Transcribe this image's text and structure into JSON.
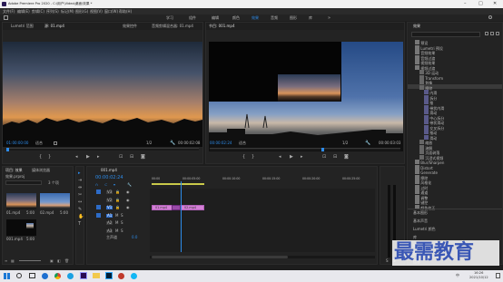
{
  "titlebar": {
    "title": "Adobe Premiere Pro 2020 - C:\\用户\\Video\\桌面\\效果 *",
    "min": "–",
    "max": "□",
    "close": "✕"
  },
  "menubar": [
    "文件(F)",
    "编辑(E)",
    "剪辑(C)",
    "序列(S)",
    "标记(M)",
    "图形(G)",
    "视图(V)",
    "窗口(W)",
    "帮助(H)"
  ],
  "workspaces": [
    "学习",
    "组件",
    "编辑",
    "颜色",
    "效果",
    "音频",
    "图形",
    "库"
  ],
  "workspace_active": "效果",
  "source": {
    "tabs": [
      "Lumetri 范围",
      "源: 01.mp4",
      "效果控件",
      "音频剪辑混合器: 01.mp4"
    ],
    "timecode_left": "01:00:00:00",
    "timecode_right": "00:00:02:08",
    "fit": "适合",
    "ratio": "1/2",
    "zoom_label": "整体"
  },
  "program": {
    "tab": "节目: 001.mp4",
    "timecode_left": "00:00:02:24",
    "fit": "适合",
    "ratio": "1/2",
    "timecode_right": "00:00:03:03"
  },
  "effects": {
    "title": "效果",
    "search_placeholder": "",
    "items": [
      "预设",
      "Lumetri 预设",
      "音频效果",
      "音频过渡",
      "视频效果",
      "视频过渡",
      "3D 运动",
      "Transform",
      "划像",
      "擦除",
      "内滑",
      "拆分",
      "推",
      "带状内滑",
      "滑动",
      "中心拆分",
      "带状滑动",
      "交叉拆分",
      "推动",
      "滑动",
      "缩放",
      "溶解",
      "页面剥落",
      "沉浸式视频",
      "Blur/Sharpen",
      "Distort",
      "Generate",
      "擦除",
      "风格化",
      "过时",
      "通道",
      "调整",
      "键控",
      "颜色校正"
    ],
    "selected": 9,
    "bottom": [
      "基本图形",
      "基本声音",
      "Lumetri 颜色",
      "库",
      "标记",
      "历史记录",
      "信息"
    ]
  },
  "project": {
    "tabs": [
      "项目: 效果",
      "媒体浏览器"
    ],
    "file": "效果.prproj",
    "count": "3 个项",
    "clips": [
      {
        "name": "01.mp4",
        "dur": "5:00"
      },
      {
        "name": "02.mp4",
        "dur": "5:00"
      },
      {
        "name": "001.mp4",
        "dur": "5:00"
      }
    ]
  },
  "timeline": {
    "tab": "001.mp4",
    "timecode": "00:00:02:24",
    "ruler": [
      "00:00",
      "00:00:05:00",
      "00:00:10:00",
      "00:00:15:00",
      "00:00:20:00",
      "00:00:25:00"
    ],
    "tracks": [
      "V3",
      "V2",
      "V1",
      "A1",
      "A2",
      "A3"
    ],
    "master": "主声道",
    "master_val": "0.0",
    "clip_a": "01.mp4",
    "clip_b": "02.mp4"
  },
  "watermark": "最需教育",
  "taskbar": {
    "time": "16:26",
    "date": "2021/10/12",
    "ime": "中"
  }
}
